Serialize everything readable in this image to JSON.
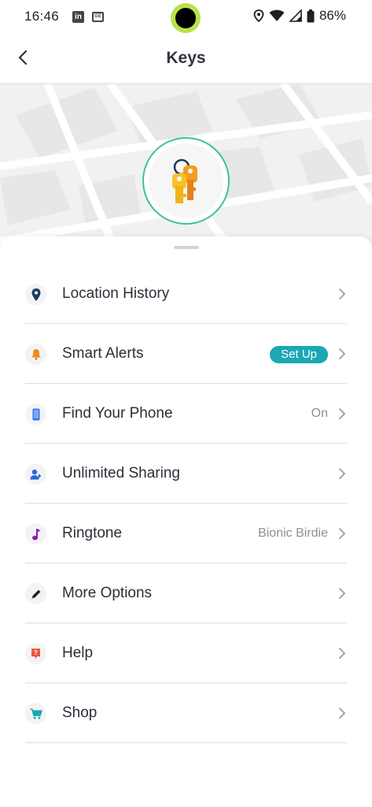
{
  "status_bar": {
    "time": "16:46",
    "battery": "86%",
    "icons": [
      "linkedin-icon",
      "news-icon",
      "location-icon",
      "wifi-icon",
      "signal-icon",
      "battery-icon"
    ]
  },
  "header": {
    "title": "Keys",
    "back_icon": "chevron-left-icon"
  },
  "item_avatar": {
    "icon": "keys-icon",
    "ring_color": "#3cc48f"
  },
  "menu": {
    "items": [
      {
        "label": "Location History",
        "icon": "location-pin-icon",
        "value": ""
      },
      {
        "label": "Smart Alerts",
        "icon": "bell-icon",
        "badge": "Set Up"
      },
      {
        "label": "Find Your Phone",
        "icon": "phone-icon",
        "value": "On"
      },
      {
        "label": "Unlimited Sharing",
        "icon": "share-user-icon",
        "value": ""
      },
      {
        "label": "Ringtone",
        "icon": "music-note-icon",
        "value": "Bionic Birdie"
      },
      {
        "label": "More Options",
        "icon": "pencil-icon",
        "value": ""
      },
      {
        "label": "Help",
        "icon": "help-icon",
        "value": ""
      },
      {
        "label": "Shop",
        "icon": "cart-icon",
        "value": ""
      }
    ]
  },
  "colors": {
    "accent_teal": "#1ba8b3",
    "ring_green": "#3cc48f",
    "text_primary": "#2b2f38",
    "text_secondary": "#8b8f96"
  }
}
